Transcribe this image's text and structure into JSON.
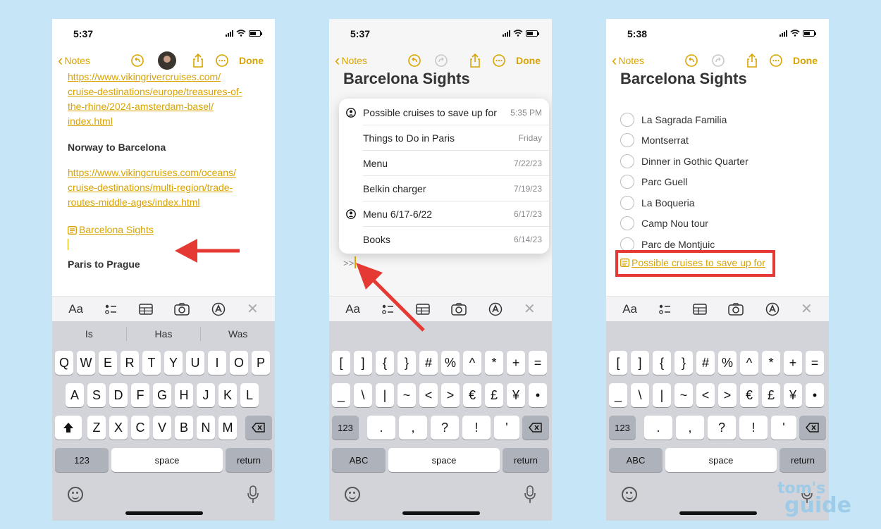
{
  "colors": {
    "accent": "#d9a300",
    "arrow": "#e53a33",
    "background": "#c6e6f7"
  },
  "phone1": {
    "time": "5:37",
    "back_label": "Notes",
    "done_label": "Done",
    "link1": [
      "https://www.vikingrivercruises.com/",
      "cruise-destinations/europe/treasures-of-",
      "the-rhine/2024-amsterdam-basel/",
      "index.html"
    ],
    "heading1": "Norway to Barcelona",
    "link2": [
      "https://www.vikingcruises.com/oceans/",
      "cruise-destinations/multi-region/trade-",
      "routes-middle-ages/index.html"
    ],
    "note_link": "Barcelona Sights",
    "heading2": "Paris to Prague",
    "toolbar": {
      "format": "Aa"
    },
    "suggestions": [
      "Is",
      "Has",
      "Was"
    ],
    "row1": [
      "Q",
      "W",
      "E",
      "R",
      "T",
      "Y",
      "U",
      "I",
      "O",
      "P"
    ],
    "row2": [
      "A",
      "S",
      "D",
      "F",
      "G",
      "H",
      "J",
      "K",
      "L"
    ],
    "row3": [
      "Z",
      "X",
      "C",
      "V",
      "B",
      "N",
      "M"
    ],
    "key_123": "123",
    "key_space": "space",
    "key_return": "return"
  },
  "phone2": {
    "time": "5:37",
    "back_label": "Notes",
    "done_label": "Done",
    "title": "Barcelona Sights",
    "menu": [
      {
        "title": "Possible cruises to save up for",
        "date": "5:35 PM",
        "shared": true
      },
      {
        "title": "Things to Do in Paris",
        "date": "Friday",
        "shared": false
      },
      {
        "title": "Menu",
        "date": "7/22/23",
        "shared": false
      },
      {
        "title": "Belkin charger",
        "date": "7/19/23",
        "shared": false
      },
      {
        "title": "Menu 6/17-6/22",
        "date": "6/17/23",
        "shared": true
      },
      {
        "title": "Books",
        "date": "6/14/23",
        "shared": false
      }
    ],
    "typed": ">>",
    "toolbar": {
      "format": "Aa"
    },
    "row1": [
      "[",
      "]",
      "{",
      "}",
      "#",
      "%",
      "^",
      "*",
      "+",
      "="
    ],
    "row2": [
      "_",
      "\\",
      "|",
      "~",
      "<",
      ">",
      "€",
      "£",
      "¥",
      "•"
    ],
    "row3": [
      ".",
      ",",
      "?",
      "!",
      "'"
    ],
    "key_123": "123",
    "key_abc": "ABC",
    "key_space": "space",
    "key_return": "return"
  },
  "phone3": {
    "time": "5:38",
    "back_label": "Notes",
    "done_label": "Done",
    "title": "Barcelona Sights",
    "checklist": [
      "La Sagrada Familia",
      "Montserrat",
      "Dinner in Gothic Quarter",
      "Parc Guell",
      "La Boqueria",
      "Camp Nou tour",
      "Parc de Montjuic"
    ],
    "note_link": "Possible cruises to save up for",
    "toolbar": {
      "format": "Aa"
    },
    "row1": [
      "[",
      "]",
      "{",
      "}",
      "#",
      "%",
      "^",
      "*",
      "+",
      "="
    ],
    "row2": [
      "_",
      "\\",
      "|",
      "~",
      "<",
      ">",
      "€",
      "£",
      "¥",
      "•"
    ],
    "row3": [
      ".",
      ",",
      "?",
      "!",
      "'"
    ],
    "key_123": "123",
    "key_abc": "ABC",
    "key_space": "space",
    "key_return": "return"
  },
  "watermark": {
    "line1": "tom's",
    "line2": "guide"
  }
}
